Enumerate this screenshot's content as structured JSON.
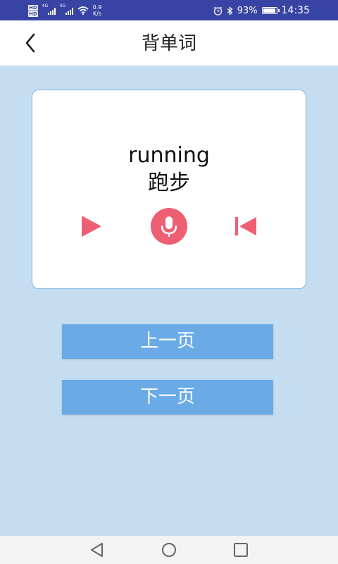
{
  "status_bar": {
    "hd_1": "HD",
    "hd_2": "HD",
    "net_1": "4G",
    "net_2": "4G",
    "speed_value": "0.9",
    "speed_unit": "K/s",
    "battery": "93%",
    "time": "14:35"
  },
  "header": {
    "title": "背单词"
  },
  "card": {
    "word": "running",
    "meaning": "跑步"
  },
  "buttons": {
    "prev": "上一页",
    "next": "下一页"
  },
  "colors": {
    "accent": "#ee5f73",
    "button": "#6aaae6",
    "background": "#c5ddf0",
    "status_bar": "#3744a4"
  },
  "icons": {
    "back": "chevron-left-icon",
    "play": "play-icon",
    "record": "microphone-icon",
    "restart": "skip-back-icon"
  }
}
